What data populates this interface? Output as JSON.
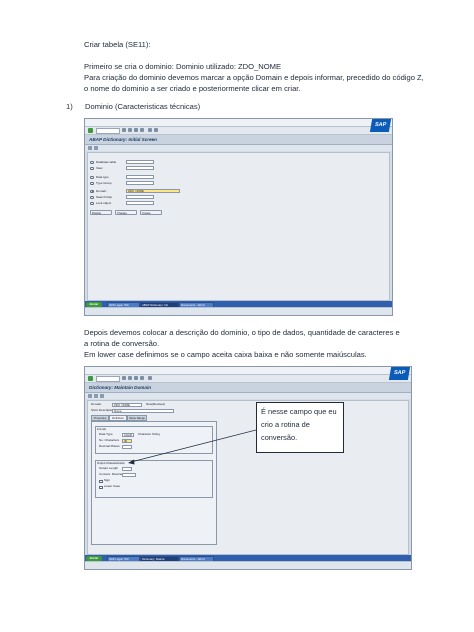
{
  "doc": {
    "heading": "Criar tabela (SE11):",
    "intro_line1": "Primeiro se cria o dominio: Dominio utilizado:  ZDO_NOME",
    "intro_line2": "Para criação do dominio devemos marcar a opção Domain e depois informar, precedido do código Z,",
    "intro_line3": "o nome do dominio a ser criado e posteriormente clicar em criar.",
    "list_number": "1)",
    "list_item": "Dominio (Caracteristicas técnicas)",
    "para2_line1": "Depois devemos colocar a descrição do dominio, o tipo de dados, quantidade de caracteres e",
    "para2_line2": "a rotina de conversão.",
    "para2_line3": "Em lower case definimos se o campo aceita caixa baixa e não somente maiúsculas."
  },
  "screen1": {
    "menu": [
      "Database Object",
      "Edit",
      "Goto",
      "Utilities",
      "Environment",
      "System",
      "Help"
    ],
    "sap_logo": "SAP",
    "title": "ABAP Dictionary: Initial Screen",
    "options": [
      {
        "label": "Database table",
        "selected": false
      },
      {
        "label": "View",
        "selected": false
      },
      {
        "label": "Data type",
        "selected": false
      },
      {
        "label": "Type Group",
        "selected": false
      },
      {
        "label": "Domain",
        "selected": true
      },
      {
        "label": "Search help",
        "selected": false
      },
      {
        "label": "Lock object",
        "selected": false
      }
    ],
    "domain_value": "ZDO_NOME",
    "buttons": [
      "Display",
      "Change",
      "Create"
    ],
    "start_label": "Iniciar",
    "tasks": [
      "SAP Logon 700",
      "ABAP Dictionary: Init",
      "Documento - Word"
    ]
  },
  "screen2": {
    "menu": [
      "Dictionary Object",
      "Edit",
      "Goto",
      "Utilities",
      "Environment",
      "System",
      "Help"
    ],
    "sap_logo": "SAP",
    "title": "Dictionary: Maintain Domain",
    "domain_label": "Domain",
    "domain_value": "ZDO_NOME",
    "status": "New(Revised)",
    "short_desc_label": "Short Description",
    "short_desc_value": "Nome",
    "tabs": [
      "Properties",
      "Definition",
      "Value Range"
    ],
    "format_group": "Format",
    "data_type_label": "Data Type",
    "data_type_value": "CHAR",
    "data_type_desc": "Character String",
    "no_chars_label": "No. Characters",
    "no_chars_value": "40",
    "decimal_label": "Decimal Places",
    "output_group": "Output Characteristics",
    "output_length_label": "Output Length",
    "conv_routine_label": "Convers. Routine",
    "sign_label": "Sign",
    "lowercase_label": "Lower Case",
    "start_label": "Iniciar",
    "tasks": [
      "SAP Logon 700",
      "Dictionary: Mainta",
      "Documento - Word"
    ]
  },
  "callout": {
    "line1": "É nesse campo que eu",
    "line2": "crio a rotina de",
    "line3": "conversão."
  }
}
